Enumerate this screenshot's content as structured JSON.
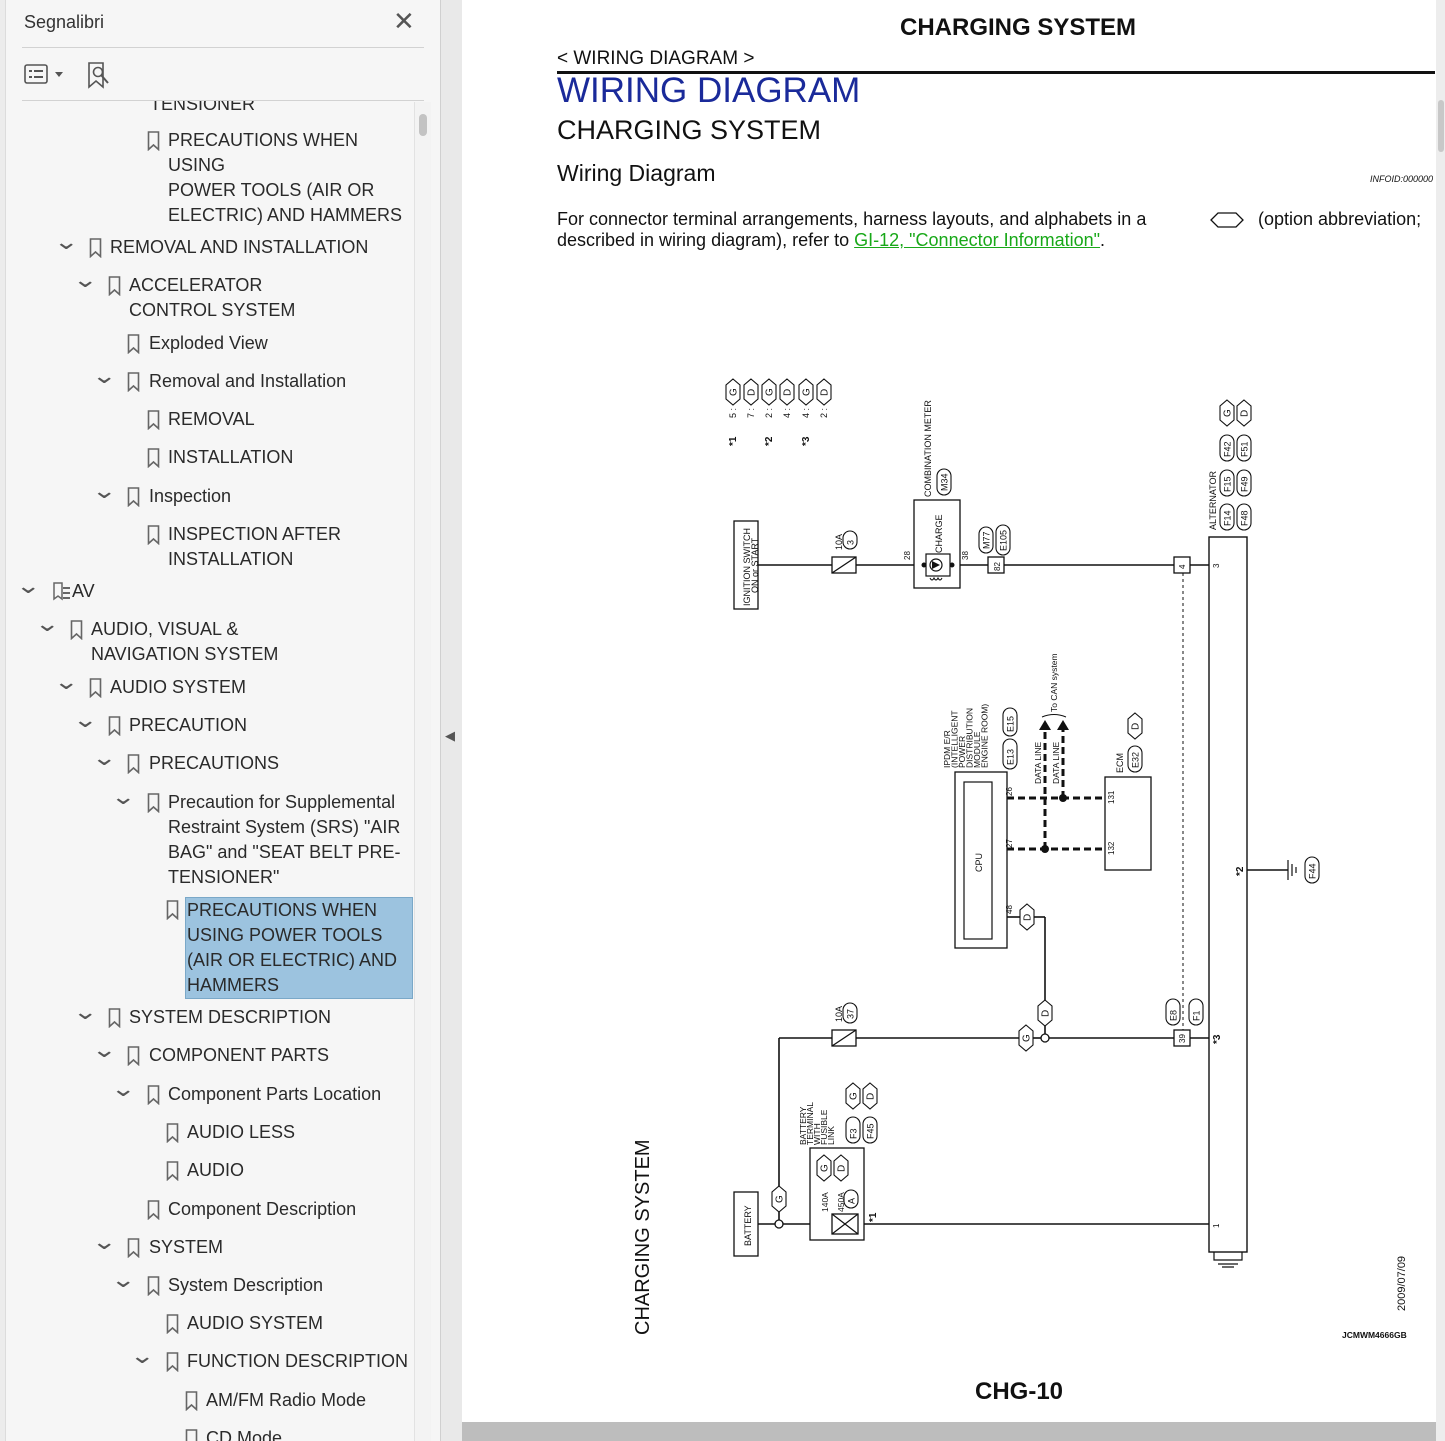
{
  "sidebar": {
    "title": "Segnalibri",
    "close_icon": "close-icon",
    "toolbar": {
      "options_icon": "list-options-icon",
      "find_icon": "bookmark-search-icon"
    },
    "items": [
      {
        "label": "TENSIONER",
        "level": 6,
        "chevron": false,
        "icon": "bookmark-icon",
        "lines": [
          "TENSIONER"
        ]
      },
      {
        "label": "PRECAUTIONS WHEN USING POWER TOOLS (AIR OR ELECTRIC) AND HAMMERS",
        "lines": [
          "PRECAUTIONS WHEN USING",
          "POWER TOOLS (AIR OR",
          "ELECTRIC) AND HAMMERS"
        ]
      },
      {
        "lines": [
          "REMOVAL AND INSTALLATION"
        ]
      },
      {
        "lines": [
          "ACCELERATOR",
          "CONTROL SYSTEM"
        ]
      },
      {
        "lines": [
          "Exploded View"
        ]
      },
      {
        "lines": [
          "Removal and Installation"
        ]
      },
      {
        "lines": [
          "REMOVAL"
        ]
      },
      {
        "lines": [
          "INSTALLATION"
        ]
      },
      {
        "lines": [
          "Inspection"
        ]
      },
      {
        "lines": [
          "INSPECTION AFTER",
          "INSTALLATION"
        ]
      },
      {
        "lines": [
          "AV"
        ]
      },
      {
        "lines": [
          "AUDIO, VISUAL &",
          "NAVIGATION SYSTEM"
        ]
      },
      {
        "lines": [
          "AUDIO SYSTEM"
        ]
      },
      {
        "lines": [
          "PRECAUTION"
        ]
      },
      {
        "lines": [
          "PRECAUTIONS"
        ]
      },
      {
        "lines": [
          "Precaution for Supplemental",
          "Restraint System (SRS) \"AIR",
          "BAG\" and \"SEAT BELT PRE-",
          "TENSIONER\""
        ]
      },
      {
        "lines": [
          "PRECAUTIONS WHEN",
          "USING POWER TOOLS",
          "(AIR OR ELECTRIC) AND",
          "HAMMERS"
        ],
        "selected": true
      },
      {
        "lines": [
          "SYSTEM DESCRIPTION"
        ]
      },
      {
        "lines": [
          "COMPONENT PARTS"
        ]
      },
      {
        "lines": [
          "Component Parts Location"
        ]
      },
      {
        "lines": [
          "AUDIO LESS"
        ]
      },
      {
        "lines": [
          "AUDIO"
        ]
      },
      {
        "lines": [
          "Component Description"
        ]
      },
      {
        "lines": [
          "SYSTEM"
        ]
      },
      {
        "lines": [
          "System Description"
        ]
      },
      {
        "lines": [
          "AUDIO SYSTEM"
        ]
      },
      {
        "lines": [
          "FUNCTION DESCRIPTION"
        ]
      },
      {
        "lines": [
          "AM/FM Radio Mode"
        ]
      },
      {
        "lines": [
          "CD Mode"
        ]
      }
    ]
  },
  "document": {
    "header": "CHARGING SYSTEM",
    "breadcrumb": "< WIRING DIAGRAM >",
    "title": "WIRING DIAGRAM",
    "subtitle": "CHARGING SYSTEM",
    "section": "Wiring Diagram",
    "info_id": "INFOID:000000",
    "body_line1_a": "For connector terminal arrangements, harness layouts, and alphabets in a",
    "body_line1_b": "(option abbreviation;",
    "body_line2_a": "described in wiring diagram), refer to",
    "body_link": "GI-12, \"Connector Information\"",
    "body_line2_end": ".",
    "page_number": "CHG-10"
  },
  "diagram": {
    "side_title": "CHARGING SYSTEM",
    "date": "2009/07/09",
    "code": "JCMWM4666GB",
    "legend": [
      {
        "mark": "*1",
        "a": "5",
        "b": "7",
        "ca": "G",
        "cb": "D"
      },
      {
        "mark": "*2",
        "a": "2",
        "b": "4",
        "ca": "G",
        "cb": "D"
      },
      {
        "mark": "*3",
        "a": "4",
        "b": "2",
        "ca": "G",
        "cb": "D"
      }
    ],
    "ignition_switch": "IGNITION SWITCH ON or START",
    "fuse1_amp": "10A",
    "fuse1_no": "3",
    "fuse2_amp": "10A",
    "fuse2_no": "37",
    "meter_name": "COMBINATION METER",
    "meter_conn": "M34",
    "meter_lamp": "CHARGE",
    "meter_pin_in": "28",
    "meter_pin_out": "38",
    "joint_conn_a": "M77",
    "joint_conn_b": "E105",
    "joint_pin": "82",
    "alt_name": "ALTERNATOR",
    "alt_pin_s": "4",
    "alt_pin_3": "3",
    "alt_pin_1": "1",
    "alt_pin_39": "39",
    "alt_conns": [
      "F42",
      "F15",
      "F49",
      "F51",
      "F14",
      "F48"
    ],
    "alt_g": "G",
    "alt_d": "D",
    "e8": "E8",
    "f1": "F1",
    "mark2": "*2",
    "mark3": "*3",
    "mark1": "*1",
    "ground_conn": "F44",
    "ipdm_name": [
      "IPDM E/R",
      "(INTELLIGENT",
      "POWER",
      "DISTRIBUTION",
      "MODULE",
      "ENGINE ROOM)"
    ],
    "ipdm_conns": [
      "E13",
      "E15"
    ],
    "cpu": "CPU",
    "ipdm_pins": [
      "26",
      "27",
      "48"
    ],
    "data_line": "DATA LINE",
    "can": "To CAN system",
    "ecm": "ECM",
    "ecm_conn": "E32",
    "ecm_d": "D",
    "ecm_pins": [
      "131",
      "132"
    ],
    "battery": "BATTERY",
    "fusible_name": [
      "BATTERY",
      "TERMINAL",
      "WITH",
      "FUSIBLE",
      "LINK"
    ],
    "fusible_conns": [
      "F3",
      "F45"
    ],
    "fusible_amp1": "140A",
    "fusible_amp2": "450A",
    "fusible_a": "A"
  }
}
